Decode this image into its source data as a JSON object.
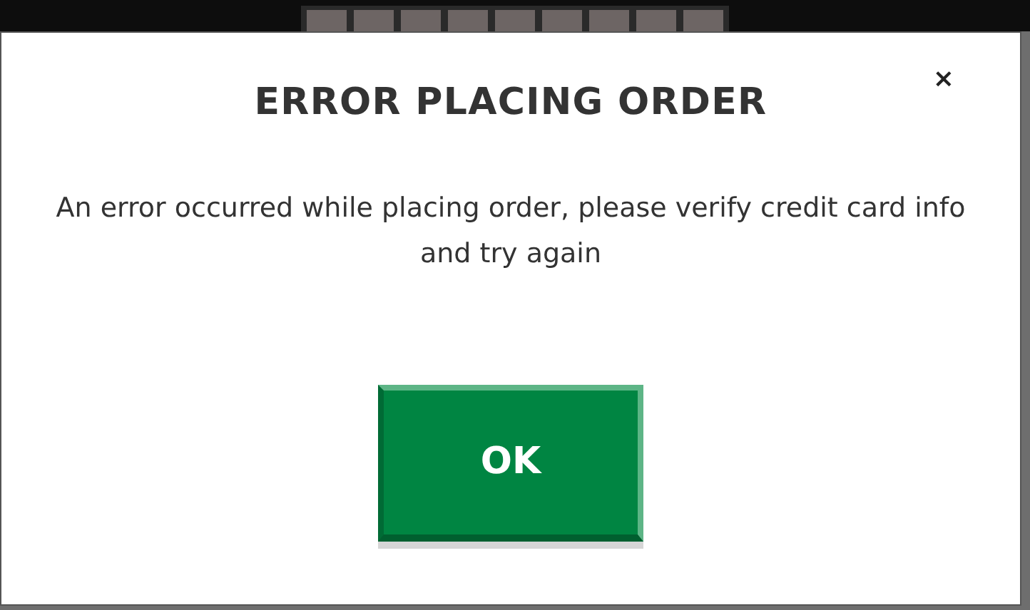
{
  "dialog": {
    "title": "ERROR PLACING ORDER",
    "close": "×",
    "message": "An error occurred while placing order, please verify credit card info and try again",
    "buttons": [
      "OK"
    ]
  }
}
